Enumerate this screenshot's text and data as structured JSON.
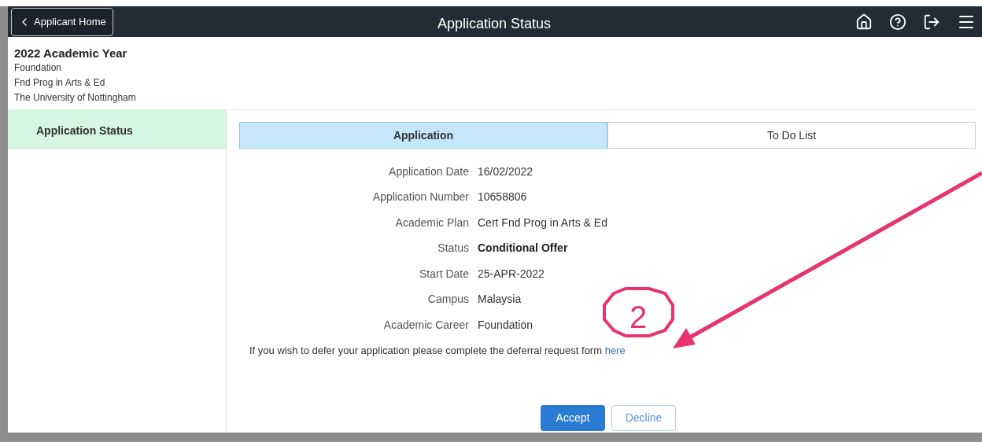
{
  "header": {
    "back_button": "Applicant Home",
    "title": "Application Status"
  },
  "context": {
    "year": "2022 Academic Year",
    "lines": [
      "Foundation",
      "Fnd Prog in Arts & Ed",
      "The University of Nottingham"
    ]
  },
  "sidebar": {
    "items": [
      {
        "label": "Application Status",
        "selected": true
      }
    ]
  },
  "tabs": [
    {
      "label": "Application",
      "selected": true
    },
    {
      "label": "To Do List",
      "selected": false
    }
  ],
  "fields": [
    {
      "label": "Application Date",
      "value": "16/02/2022",
      "bold": false
    },
    {
      "label": "Application Number",
      "value": "10658806",
      "bold": false
    },
    {
      "label": "Academic Plan",
      "value": "Cert Fnd Prog in Arts & Ed",
      "bold": false
    },
    {
      "label": "Status",
      "value": "Conditional Offer",
      "bold": true
    },
    {
      "label": "Start Date",
      "value": "25-APR-2022",
      "bold": false
    },
    {
      "label": "Campus",
      "value": "Malaysia",
      "bold": false
    },
    {
      "label": "Academic Career",
      "value": "Foundation",
      "bold": false
    }
  ],
  "deferral_note": {
    "text": "If you wish to defer your application please complete the deferral request form",
    "link": "here"
  },
  "buttons": [
    {
      "label": "Accept",
      "kind": "primary"
    },
    {
      "label": "Decline",
      "kind": "secondary"
    }
  ],
  "annotation": {
    "number": "2"
  }
}
